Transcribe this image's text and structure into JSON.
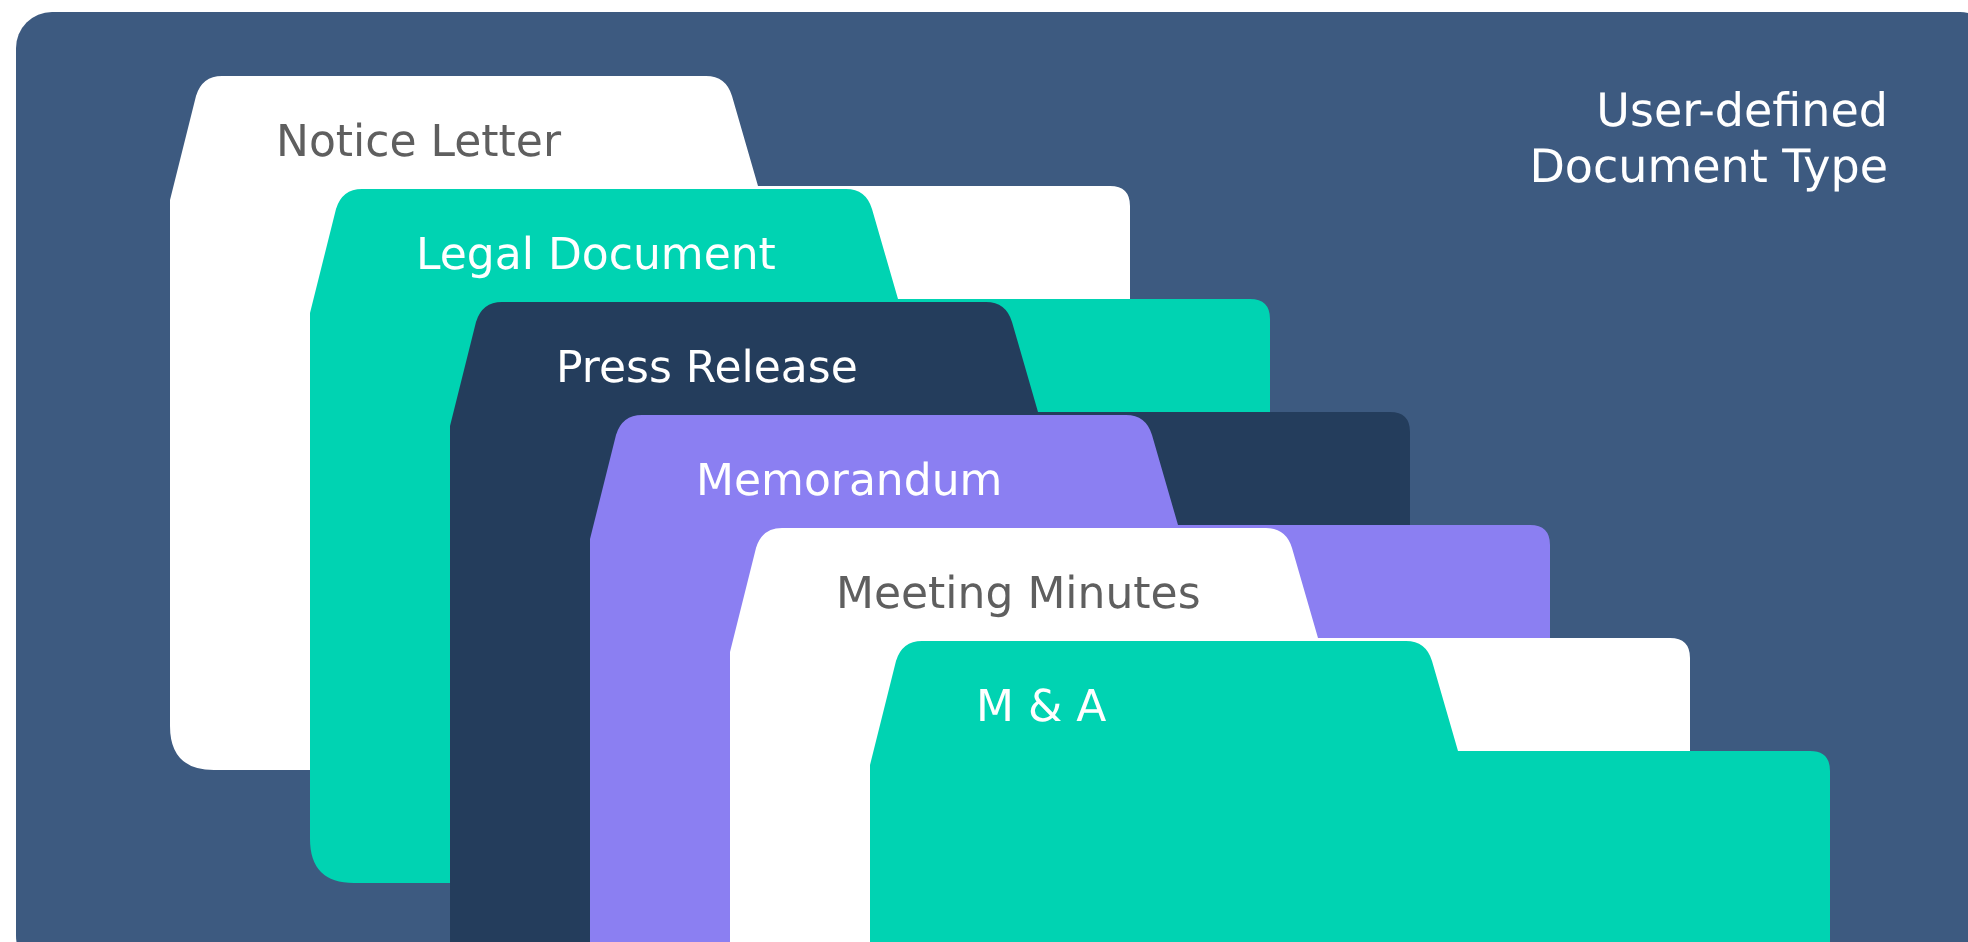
{
  "title": "User-defined Document Type",
  "folders": [
    {
      "label": "Notice Letter",
      "color": "#ffffff"
    },
    {
      "label": "Legal Document",
      "color": "#00d3b2"
    },
    {
      "label": "Press Release",
      "color": "#243d5c"
    },
    {
      "label": "Memorandum",
      "color": "#8b7ff2"
    },
    {
      "label": "Meeting Minutes",
      "color": "#ffffff"
    },
    {
      "label": "M & A",
      "color": "#00d3b2"
    }
  ]
}
